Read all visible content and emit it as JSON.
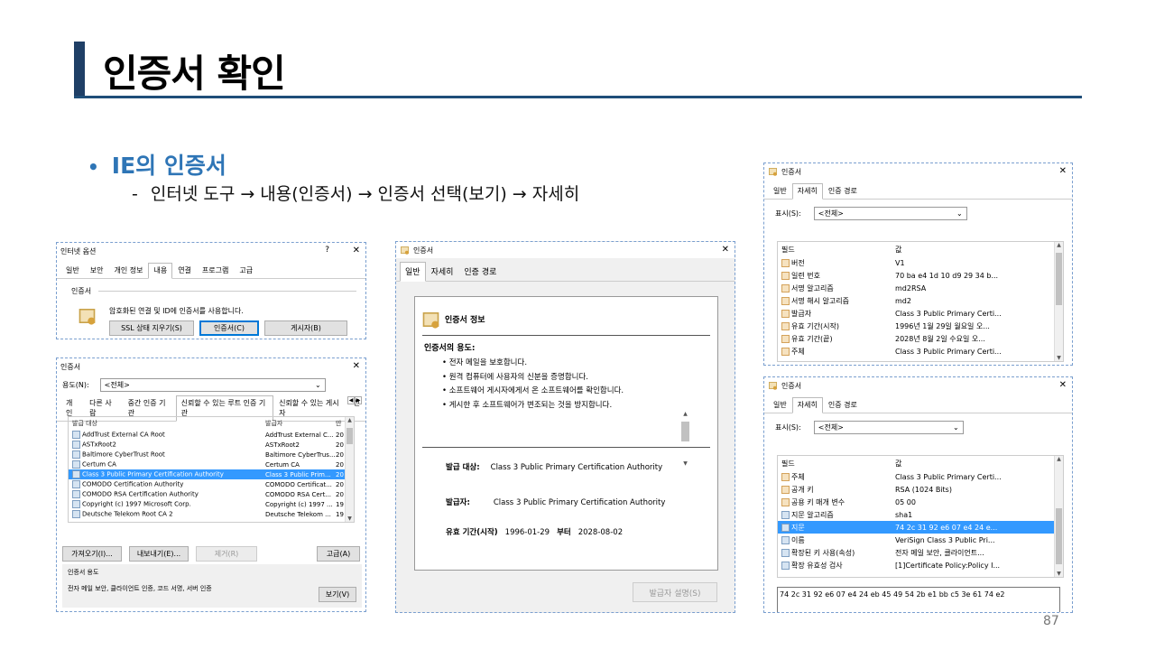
{
  "slide": {
    "title": "인증서 확인",
    "bullet": "IE의 인증서",
    "sub": "인터넷 도구 → 내용(인증서) → 인증서 선택(보기) → 자세히",
    "page_number": "87"
  },
  "internet_options": {
    "title": "인터넷 옵션",
    "help": "?",
    "close": "✕",
    "tabs": [
      "일반",
      "보안",
      "개인 정보",
      "내용",
      "연결",
      "프로그램",
      "고급"
    ],
    "section": "인증서",
    "description": "암호화된 연결 및 ID에 인증서를 사용합니다.",
    "buttons": [
      "SSL 상태 지우기(S)",
      "인증서(C)",
      "게시자(B)"
    ]
  },
  "cert_manager": {
    "title": "인증서",
    "close": "✕",
    "purpose_label": "용도(N):",
    "purpose_value": "<전체>",
    "tabs": [
      "개인",
      "다른 사람",
      "중간 인증 기관",
      "신뢰할 수 있는 루트 인증 기관",
      "신뢰할 수 있는 게시자",
      "신"
    ],
    "columns": [
      "발급 대상",
      "발급자",
      "만"
    ],
    "rows": [
      [
        "AddTrust External CA Root",
        "AddTrust External C...",
        "20"
      ],
      [
        "ASTxRoot2",
        "ASTxRoot2",
        "20"
      ],
      [
        "Baltimore CyberTrust Root",
        "Baltimore CyberTrus...",
        "20"
      ],
      [
        "Certum CA",
        "Certum CA",
        "20"
      ],
      [
        "Class 3 Public Primary Certification Authority",
        "Class 3 Public Prim...",
        "20"
      ],
      [
        "COMODO Certification Authority",
        "COMODO Certificat...",
        "20"
      ],
      [
        "COMODO RSA Certification Authority",
        "COMODO RSA Cert...",
        "20"
      ],
      [
        "Copyright (c) 1997 Microsoft Corp.",
        "Copyright (c) 1997 ...",
        "19"
      ],
      [
        "Deutsche Telekom Root CA 2",
        "Deutsche Telekom ...",
        "19"
      ]
    ],
    "selected_row": 4,
    "buttons": {
      "import": "가져오기(I)...",
      "export": "내보내기(E)...",
      "remove": "제거(R)",
      "advanced": "고급(A)",
      "view": "보기(V)"
    },
    "usage_label": "인증서 용도",
    "usage_value": "전자 메일 보안, 클라이언트 인증, 코드 서명, 서버 인증"
  },
  "cert_general": {
    "title": "인증서",
    "close": "✕",
    "tabs": [
      "일반",
      "자세히",
      "인증 경로"
    ],
    "info_title": "인증서 정보",
    "purpose_title": "인증서의 용도:",
    "purposes": [
      "• 전자 메일을 보호합니다.",
      "• 원격 컴퓨터에 사용자의 신분을 증명합니다.",
      "• 소프트웨어 게시자에게서 온 소프트웨어를 확인합니다.",
      "• 게시한 후 소프트웨어가 변조되는 것을 방지합니다."
    ],
    "issued_to_label": "발급 대상:",
    "issued_to": "Class 3 Public Primary Certification Authority",
    "issuer_label": "발급자:",
    "issuer": "Class 3 Public Primary Certification Authority",
    "validity_label": "유효 기간(시작)",
    "valid_from": "1996-01-29",
    "to_label": "부터",
    "valid_to": "2028-08-02",
    "issuer_statement_button": "발급자 설명(S)"
  },
  "details_top": {
    "title": "인증서",
    "close": "✕",
    "tabs": [
      "일반",
      "자세히",
      "인증 경로"
    ],
    "show_label": "표시(S):",
    "show_value": "<전체>",
    "columns": [
      "필드",
      "값"
    ],
    "rows": [
      [
        "버전",
        "V1"
      ],
      [
        "일련 번호",
        "70 ba e4 1d 10 d9 29 34 b..."
      ],
      [
        "서명 알고리즘",
        "md2RSA"
      ],
      [
        "서명 해시 알고리즘",
        "md2"
      ],
      [
        "발급자",
        "Class 3 Public Primary Certi..."
      ],
      [
        "유효 기간(시작)",
        "1996년 1월 29일 월요일 오..."
      ],
      [
        "유효 기간(끝)",
        "2028년 8월 2일 수요일 오..."
      ],
      [
        "주체",
        "Class 3 Public Primary Certi..."
      ]
    ]
  },
  "details_bottom": {
    "title": "인증서",
    "close": "✕",
    "tabs": [
      "일반",
      "자세히",
      "인증 경로"
    ],
    "show_label": "표시(S):",
    "show_value": "<전체>",
    "columns": [
      "필드",
      "값"
    ],
    "rows": [
      [
        "주체",
        "Class 3 Public Primary Certi..."
      ],
      [
        "공개 키",
        "RSA (1024 Bits)"
      ],
      [
        "공용 키 매개 변수",
        "05 00"
      ],
      [
        "지문 알고리즘",
        "sha1"
      ],
      [
        "지문",
        "74 2c 31 92 e6 07 e4 24 e..."
      ],
      [
        "이름",
        "VeriSign Class 3 Public Pri..."
      ],
      [
        "확장된 키 사용(속성)",
        "전자 메일 보안, 클라이언트..."
      ],
      [
        "확장 유효성 검사",
        "[1]Certificate Policy:Policy I..."
      ]
    ],
    "selected_row": 4,
    "value": "74 2c 31 92 e6 07 e4 24 eb 45 49 54 2b e1 bb c5 3e 61 74 e2"
  }
}
